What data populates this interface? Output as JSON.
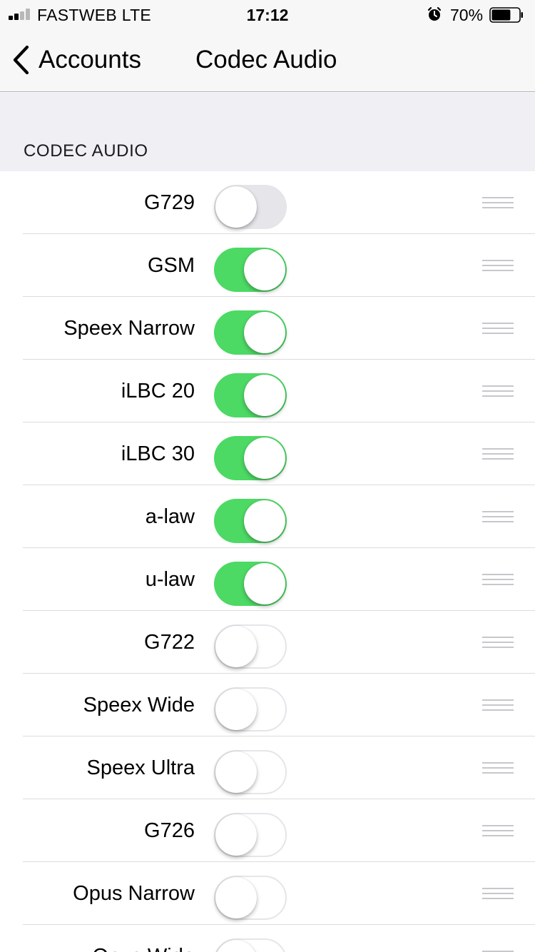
{
  "status_bar": {
    "carrier": "FASTWEB  LTE",
    "time": "17:12",
    "battery_percent": "70%",
    "battery_level": 0.7,
    "signal_bars_filled": 2,
    "icons": [
      "signal-icon",
      "alarm-icon",
      "battery-icon"
    ]
  },
  "nav": {
    "back_label": "Accounts",
    "title": "Codec Audio"
  },
  "section": {
    "title": "CODEC AUDIO"
  },
  "codecs": [
    {
      "label": "G729",
      "enabled": false,
      "pressed": true
    },
    {
      "label": "GSM",
      "enabled": true
    },
    {
      "label": "Speex Narrow",
      "enabled": true
    },
    {
      "label": "iLBC 20",
      "enabled": true
    },
    {
      "label": "iLBC 30",
      "enabled": true
    },
    {
      "label": "a-law",
      "enabled": true
    },
    {
      "label": "u-law",
      "enabled": true
    },
    {
      "label": "G722",
      "enabled": false
    },
    {
      "label": "Speex Wide",
      "enabled": false
    },
    {
      "label": "Speex Ultra",
      "enabled": false
    },
    {
      "label": "G726",
      "enabled": false
    },
    {
      "label": "Opus Narrow",
      "enabled": false
    },
    {
      "label": "Opus Wide",
      "enabled": false
    }
  ],
  "colors": {
    "toggle_on": "#4cd964",
    "toggle_off_border": "#e5e5ea",
    "grouped_background": "#efeff4"
  }
}
